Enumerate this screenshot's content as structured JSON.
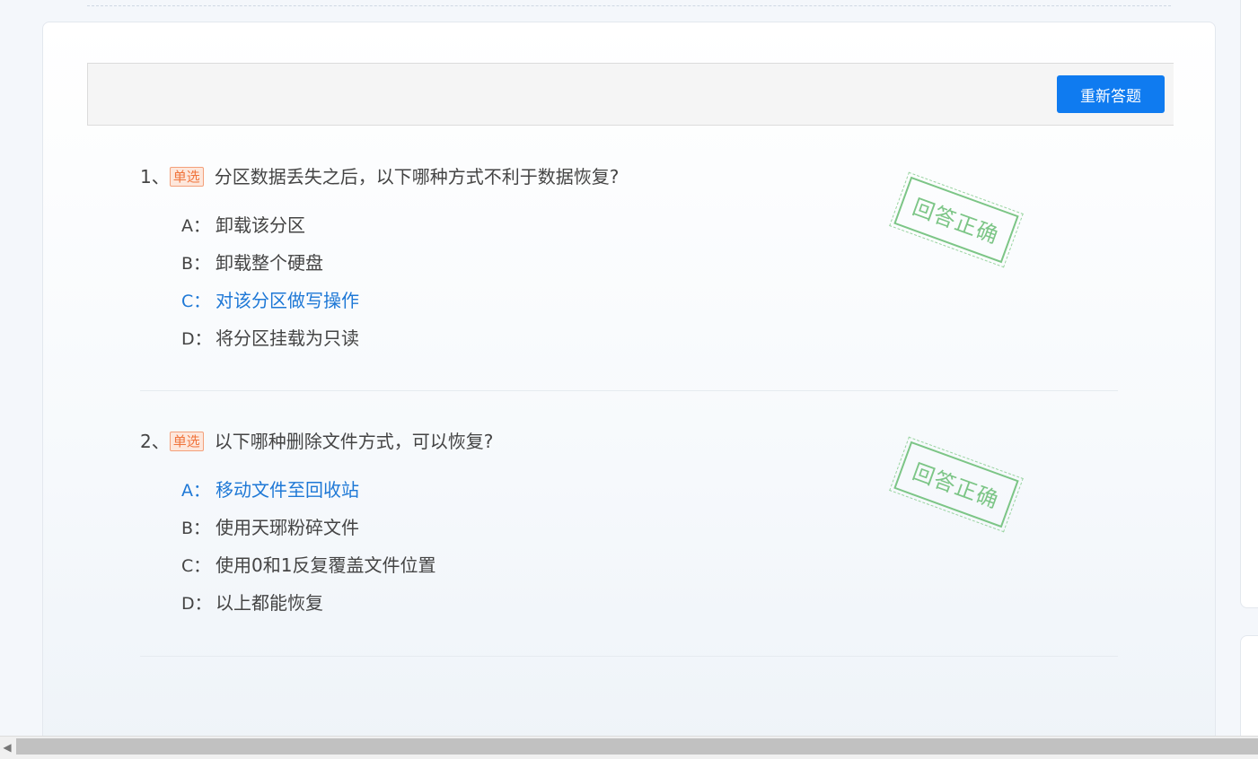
{
  "toolbar": {
    "redo_label": "重新答题"
  },
  "questions": [
    {
      "number": "1、",
      "type_badge": "单选",
      "text": "分区数据丢失之后，以下哪种方式不利于数据恢复?",
      "stamp": "回答正确",
      "options": [
        {
          "key": "A：",
          "text": "卸载该分区",
          "selected": false
        },
        {
          "key": "B：",
          "text": "卸载整个硬盘",
          "selected": false
        },
        {
          "key": "C：",
          "text": "对该分区做写操作",
          "selected": true
        },
        {
          "key": "D：",
          "text": "将分区挂载为只读",
          "selected": false
        }
      ]
    },
    {
      "number": "2、",
      "type_badge": "单选",
      "text": "以下哪种删除文件方式，可以恢复?",
      "stamp": "回答正确",
      "options": [
        {
          "key": "A：",
          "text": "移动文件至回收站",
          "selected": true
        },
        {
          "key": "B：",
          "text": "使用天琊粉碎文件",
          "selected": false
        },
        {
          "key": "C：",
          "text": "使用0和1反复覆盖文件位置",
          "selected": false
        },
        {
          "key": "D：",
          "text": "以上都能恢复",
          "selected": false
        }
      ]
    }
  ],
  "colors": {
    "primary": "#0f7bf0",
    "selected_option": "#1e78d6",
    "badge": "#f0743c",
    "stamp": "#6fc07a"
  },
  "icons": {
    "scroll_left": "chevron-left-icon"
  }
}
